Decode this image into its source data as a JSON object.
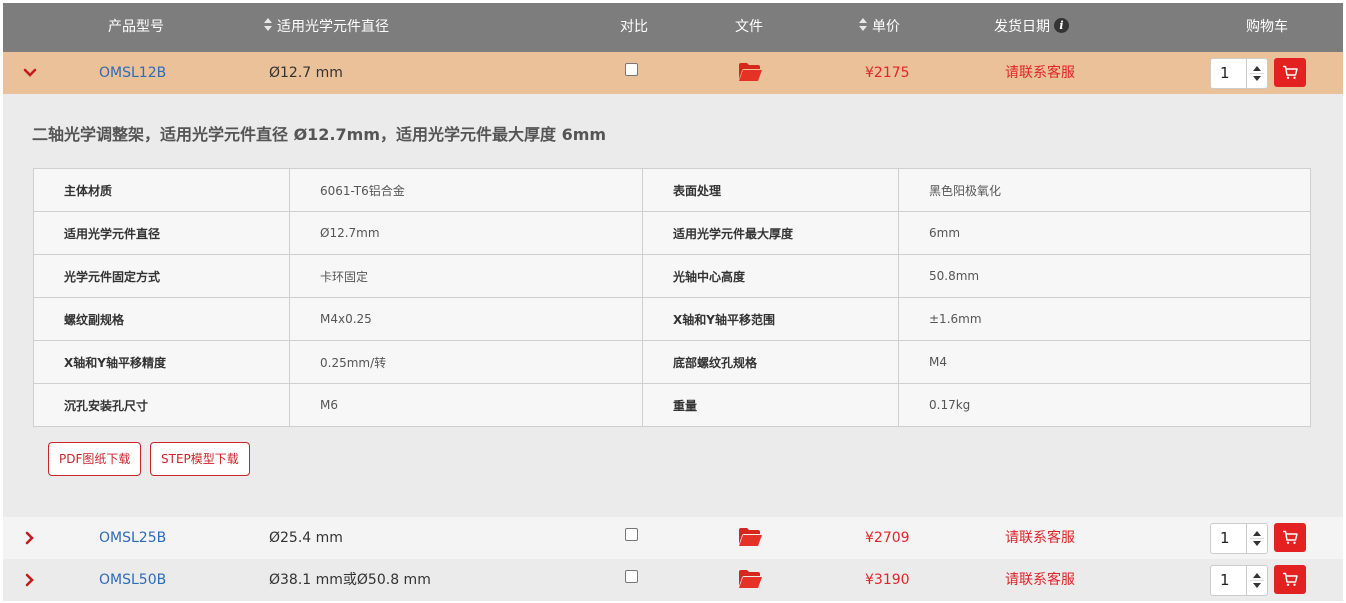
{
  "header": {
    "model": "产品型号",
    "diameter": "适用光学元件直径",
    "compare": "对比",
    "file": "文件",
    "price": "单价",
    "ship_date": "发货日期",
    "cart": "购物车"
  },
  "rows": [
    {
      "model": "OMSL12B",
      "diameter": "Ø12.7 mm",
      "price": "¥2175",
      "ship": "请联系客服",
      "qty": "1"
    },
    {
      "model": "OMSL25B",
      "diameter": "Ø25.4 mm",
      "price": "¥2709",
      "ship": "请联系客服",
      "qty": "1"
    },
    {
      "model": "OMSL50B",
      "diameter": "Ø38.1 mm或Ø50.8 mm",
      "price": "¥3190",
      "ship": "请联系客服",
      "qty": "1"
    }
  ],
  "detail": {
    "title": "二轴光学调整架，适用光学元件直径 Ø12.7mm，适用光学元件最大厚度 6mm",
    "specs": [
      {
        "k1": "主体材质",
        "v1": "6061-T6铝合金",
        "k2": "表面处理",
        "v2": "黑色阳极氧化"
      },
      {
        "k1": "适用光学元件直径",
        "v1": "Ø12.7mm",
        "k2": "适用光学元件最大厚度",
        "v2": "6mm"
      },
      {
        "k1": "光学元件固定方式",
        "v1": "卡环固定",
        "k2": "光轴中心高度",
        "v2": "50.8mm"
      },
      {
        "k1": "螺纹副规格",
        "v1": "M4x0.25",
        "k2": "X轴和Y轴平移范围",
        "v2": "±1.6mm"
      },
      {
        "k1": "X轴和Y轴平移精度",
        "v1": "0.25mm/转",
        "k2": "底部螺纹孔规格",
        "v2": "M4"
      },
      {
        "k1": "沉孔安装孔尺寸",
        "v1": "M6",
        "k2": "重量",
        "v2": "0.17kg"
      }
    ],
    "pdf_button": "PDF图纸下载",
    "step_button": "STEP模型下载"
  },
  "icons": {
    "expand": "chevron-down-icon",
    "collapse": "chevron-right-icon",
    "file": "folder-open-icon",
    "cart": "cart-icon",
    "info": "info-icon",
    "sort": "sort-icon"
  },
  "colors": {
    "header_bg": "#7d7d7d",
    "active_row": "#eac199",
    "accent_red": "#e32121",
    "link_blue": "#2e6bb8"
  }
}
